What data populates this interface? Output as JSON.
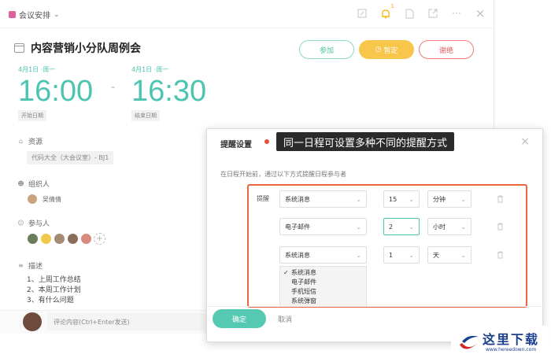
{
  "app": {
    "calendar_name": "会议安排"
  },
  "event": {
    "title": "内容营销小分队周例会",
    "buttons": {
      "join": "参加",
      "tentative": "暂定",
      "decline": "谢绝"
    },
    "start": {
      "date": "4月1日 ·周一",
      "time": "16:00",
      "label": "开始日期"
    },
    "end": {
      "date": "4月1日 ·周一",
      "time": "16:30",
      "label": "结束日期"
    },
    "separator": "-",
    "resource": {
      "heading": "资源",
      "value": "代码大全（大会议室）- BJ1"
    },
    "organizer": {
      "heading": "组织人",
      "name": "吴倩倩"
    },
    "attendees": {
      "heading": "参与人",
      "count": 5
    },
    "description": {
      "heading": "描述",
      "lines": [
        "1、上周工作总结",
        "2、本周工作计划",
        "3、有什么问题"
      ]
    },
    "comment_placeholder": "评论内容(Ctrl+Enter发送)"
  },
  "dialog": {
    "title": "提醒设置",
    "callout": "同一日程可设置多种不同的提醒方式",
    "description": "在日程开始前，通过以下方式提醒日程参与者",
    "remind_label": "提醒",
    "rows": [
      {
        "method": "系统消息",
        "amount": "15",
        "unit": "分钟"
      },
      {
        "method": "电子邮件",
        "amount": "2",
        "unit": "小时"
      },
      {
        "method": "系统消息",
        "amount": "1",
        "unit": "天"
      }
    ],
    "dropdown_options": [
      "系统消息",
      "电子邮件",
      "手机短信",
      "系统弹窗"
    ],
    "dropdown_selected": "系统消息",
    "ok": "确定",
    "cancel": "取消",
    "close_glyph": "×"
  },
  "watermark": {
    "text": "这里下载",
    "url": "www.hereedown.com"
  },
  "colors": {
    "accent": "#4cc4b0",
    "tentative": "#f7c64a",
    "decline": "#e85c5c",
    "highlight_box": "#e8663c"
  }
}
